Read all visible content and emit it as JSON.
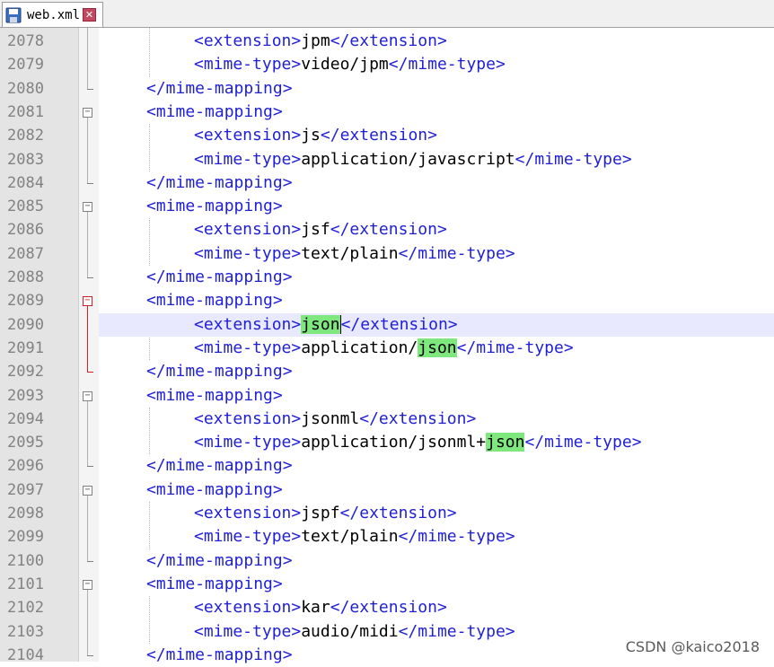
{
  "tab": {
    "filename": "web.xml",
    "close_glyph": "✕",
    "icons": {
      "save": "save-disk-icon",
      "close": "close-icon"
    }
  },
  "colors": {
    "tag": "#1f1fd6",
    "text": "#000000",
    "highlight": "#7ee87e",
    "current_line": "#e8e8ff",
    "fold_active": "#d02020",
    "gutter": "#e4e4e4"
  },
  "lines": [
    {
      "num": "2078",
      "indent": 2,
      "open": "<extension>",
      "value": "jpm",
      "close": "</extension>"
    },
    {
      "num": "2079",
      "indent": 2,
      "open": "<mime-type>",
      "value": "video/jpm",
      "close": "</mime-type>"
    },
    {
      "num": "2080",
      "indent": 1,
      "open": "</mime-mapping>",
      "value": "",
      "close": ""
    },
    {
      "num": "2081",
      "indent": 1,
      "open": "<mime-mapping>",
      "value": "",
      "close": ""
    },
    {
      "num": "2082",
      "indent": 2,
      "open": "<extension>",
      "value": "js",
      "close": "</extension>"
    },
    {
      "num": "2083",
      "indent": 2,
      "open": "<mime-type>",
      "value": "application/javascript",
      "close": "</mime-type>"
    },
    {
      "num": "2084",
      "indent": 1,
      "open": "</mime-mapping>",
      "value": "",
      "close": ""
    },
    {
      "num": "2085",
      "indent": 1,
      "open": "<mime-mapping>",
      "value": "",
      "close": ""
    },
    {
      "num": "2086",
      "indent": 2,
      "open": "<extension>",
      "value": "jsf",
      "close": "</extension>"
    },
    {
      "num": "2087",
      "indent": 2,
      "open": "<mime-type>",
      "value": "text/plain",
      "close": "</mime-type>"
    },
    {
      "num": "2088",
      "indent": 1,
      "open": "</mime-mapping>",
      "value": "",
      "close": ""
    },
    {
      "num": "2089",
      "indent": 1,
      "open": "<mime-mapping>",
      "value": "",
      "close": ""
    },
    {
      "num": "2090",
      "indent": 2,
      "open": "<extension>",
      "value_pre": "",
      "value_hl": "json",
      "value_post": "",
      "close": "</extension>",
      "current": true
    },
    {
      "num": "2091",
      "indent": 2,
      "open": "<mime-type>",
      "value_pre": "application/",
      "value_hl": "json",
      "value_post": "",
      "close": "</mime-type>"
    },
    {
      "num": "2092",
      "indent": 1,
      "open": "</mime-mapping>",
      "value": "",
      "close": ""
    },
    {
      "num": "2093",
      "indent": 1,
      "open": "<mime-mapping>",
      "value": "",
      "close": ""
    },
    {
      "num": "2094",
      "indent": 2,
      "open": "<extension>",
      "value": "jsonml",
      "close": "</extension>"
    },
    {
      "num": "2095",
      "indent": 2,
      "open": "<mime-type>",
      "value_pre": "application/jsonml+",
      "value_hl": "json",
      "value_post": "",
      "close": "</mime-type>"
    },
    {
      "num": "2096",
      "indent": 1,
      "open": "</mime-mapping>",
      "value": "",
      "close": ""
    },
    {
      "num": "2097",
      "indent": 1,
      "open": "<mime-mapping>",
      "value": "",
      "close": ""
    },
    {
      "num": "2098",
      "indent": 2,
      "open": "<extension>",
      "value": "jspf",
      "close": "</extension>"
    },
    {
      "num": "2099",
      "indent": 2,
      "open": "<mime-type>",
      "value": "text/plain",
      "close": "</mime-type>"
    },
    {
      "num": "2100",
      "indent": 1,
      "open": "</mime-mapping>",
      "value": "",
      "close": ""
    },
    {
      "num": "2101",
      "indent": 1,
      "open": "<mime-mapping>",
      "value": "",
      "close": ""
    },
    {
      "num": "2102",
      "indent": 2,
      "open": "<extension>",
      "value": "kar",
      "close": "</extension>"
    },
    {
      "num": "2103",
      "indent": 2,
      "open": "<mime-type>",
      "value": "audio/midi",
      "close": "</mime-type>"
    },
    {
      "num": "2104",
      "indent": 1,
      "open": "</mime-mapping>",
      "value": "",
      "close": ""
    }
  ],
  "watermark": "CSDN @kaico2018"
}
